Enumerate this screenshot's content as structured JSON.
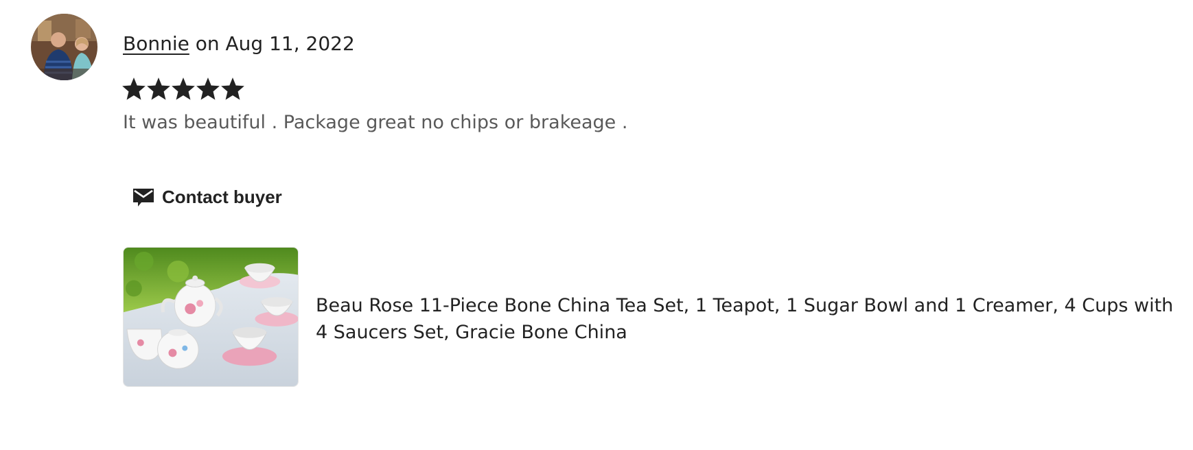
{
  "review": {
    "reviewer_name": "Bonnie",
    "date_text": " on Aug 11, 2022",
    "rating": 5,
    "rating_max": 5,
    "text": "It was beautiful . Package great no chips or brakeage ."
  },
  "actions": {
    "contact_label": "Contact buyer",
    "contact_icon": "envelope-icon"
  },
  "product": {
    "title": "Beau Rose 11-Piece Bone China Tea Set, 1 Teapot, 1 Sugar Bowl and 1 Creamer, 4 Cups with 4 Saucers Set, Gracie Bone China"
  },
  "colors": {
    "text": "#222222",
    "muted_text": "#595959",
    "star": "#222222"
  }
}
